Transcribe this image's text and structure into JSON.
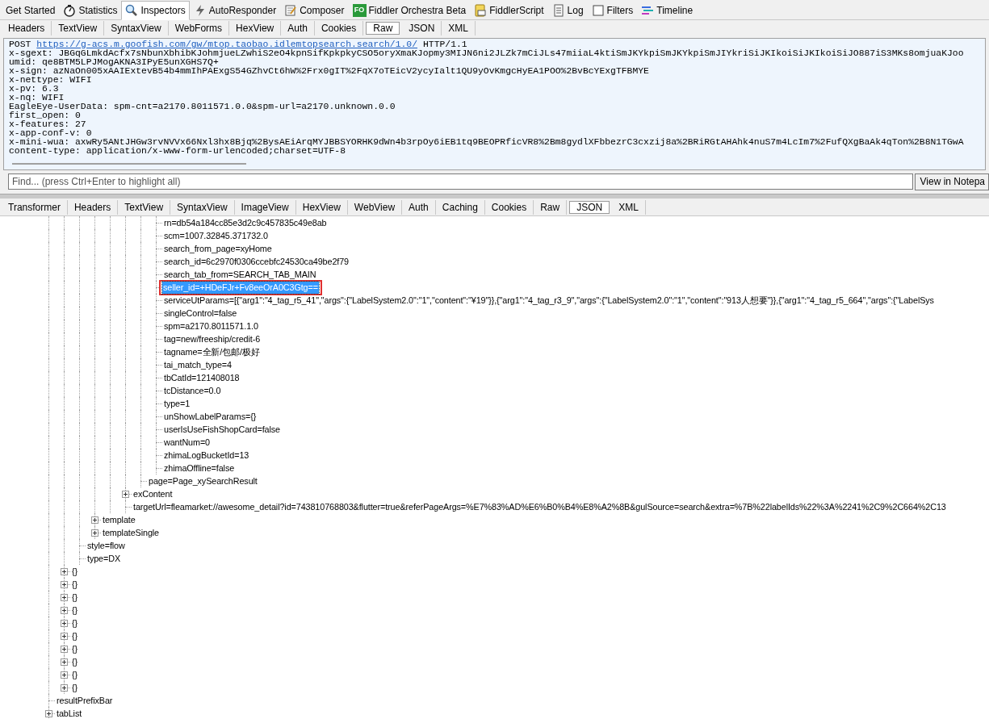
{
  "main_tabs": [
    {
      "label": "Get Started",
      "selected": false
    },
    {
      "label": "Statistics",
      "selected": false
    },
    {
      "label": "Inspectors",
      "selected": true
    },
    {
      "label": "AutoResponder",
      "selected": false
    },
    {
      "label": "Composer",
      "selected": false
    },
    {
      "label": "Fiddler Orchestra Beta",
      "selected": false,
      "badge": "FO"
    },
    {
      "label": "FiddlerScript",
      "selected": false
    },
    {
      "label": "Log",
      "selected": false
    },
    {
      "label": "Filters",
      "selected": false
    },
    {
      "label": "Timeline",
      "selected": false
    }
  ],
  "request_tabs": [
    {
      "label": "Headers",
      "selected": false
    },
    {
      "label": "TextView",
      "selected": false
    },
    {
      "label": "SyntaxView",
      "selected": false
    },
    {
      "label": "WebForms",
      "selected": false
    },
    {
      "label": "HexView",
      "selected": false
    },
    {
      "label": "Auth",
      "selected": false
    },
    {
      "label": "Cookies",
      "selected": false
    },
    {
      "label": "Raw",
      "selected": true
    },
    {
      "label": "JSON",
      "selected": false
    },
    {
      "label": "XML",
      "selected": false
    }
  ],
  "raw_request": {
    "method": "POST",
    "url": "https://g-acs.m.goofish.com/gw/mtop.taobao.idlemtopsearch.search/1.0/",
    "protocol": "HTTP/1.1",
    "lines": [
      "x-sgext: JBGqGLmkdAcfx7sNbunXbhibKJohmjueLZwhiS2eO4kpnSifKpkpkyCSO5oryXmaKJopmy3MIJN6ni2JLZk7mCiJLs47miiaL4ktiSmJKYkpiSmJKYkpiSmJIYkriSiJKIkoiSiJKIkoiSiJO887iS3MKs8omjuaKJoo",
      "umid: qe8BTM5LPJMogAKNA3IPyE5unXGHS7Q+",
      "x-sign: azNaOn005xAAIExtevB54b4mmIhPAExgS54GZhvCt6hW%2Frx0gIT%2FqX7oTEicV2ycyIalt1QU9yOvKmgcHyEA1POO%2BvBcYExgTFBMYE",
      "x-nettype: WIFI",
      "x-pv: 6.3",
      "x-nq: WIFI",
      "EagleEye-UserData: spm-cnt=a2170.8011571.0.0&spm-url=a2170.unknown.0.0",
      "first_open: 0",
      "x-features: 27",
      "x-app-conf-v: 0",
      "x-mini-wua: axwRy5ANtJHGw3rvNVVx66Nxl3hx8Bjq%2BysAEiArqMYJBBSYORHK9dWn4b3rpOy6iEB1tq9BEOPRficVR8%2Bm8gydlXFbbezrC3cxzij8a%2BRiRGtAHAhk4nuS7m4LcIm7%2FufQXgBaAk4qTon%2B8N1TGwA",
      "content-type: application/x-www-form-urlencoded;charset=UTF-8"
    ]
  },
  "find_bar": {
    "placeholder": "Find... (press Ctrl+Enter to highlight all)",
    "button": "View in Notepa"
  },
  "response_tabs": [
    {
      "label": "Transformer",
      "selected": false
    },
    {
      "label": "Headers",
      "selected": false
    },
    {
      "label": "TextView",
      "selected": false
    },
    {
      "label": "SyntaxView",
      "selected": false
    },
    {
      "label": "ImageView",
      "selected": false
    },
    {
      "label": "HexView",
      "selected": false
    },
    {
      "label": "WebView",
      "selected": false
    },
    {
      "label": "Auth",
      "selected": false
    },
    {
      "label": "Caching",
      "selected": false
    },
    {
      "label": "Cookies",
      "selected": false
    },
    {
      "label": "Raw",
      "selected": false
    },
    {
      "label": "JSON",
      "selected": true
    },
    {
      "label": "XML",
      "selected": false
    }
  ],
  "json_tree": [
    {
      "children": [
        {
          "children": [
            {
              "children": [
                {
                  "children": [
                    {
                      "children": [
                        {
                          "children": [
                            {
                              "children": [
                                {
                                  "label": "rn=db54a184cc85e3d2c9c457835c49e8ab",
                                  "selected": false
                                },
                                {
                                  "label": "scm=1007.32845.371732.0",
                                  "selected": false
                                },
                                {
                                  "label": "search_from_page=xyHome",
                                  "selected": false
                                },
                                {
                                  "label": "search_id=6c2970f0306ccebfc24530ca49be2f79",
                                  "selected": false
                                },
                                {
                                  "label": "search_tab_from=SEARCH_TAB_MAIN",
                                  "selected": false
                                },
                                {
                                  "label": "seller_id=+HDeFJr+Fv8eeOrA0C3Gtg==",
                                  "selected": true,
                                  "highlighted": true
                                },
                                {
                                  "label": "serviceUtParams=[{\"arg1\":\"4_tag_r5_41\",\"args\":{\"LabelSystem2.0\":\"1\",\"content\":\"¥19\"}},{\"arg1\":\"4_tag_r3_9\",\"args\":{\"LabelSystem2.0\":\"1\",\"content\":\"913人想要\"}},{\"arg1\":\"4_tag_r5_664\",\"args\":{\"LabelSys",
                                  "selected": false
                                },
                                {
                                  "label": "singleControl=false",
                                  "selected": false
                                },
                                {
                                  "label": "spm=a2170.8011571.1.0",
                                  "selected": false
                                },
                                {
                                  "label": "tag=new/freeship/credit-6",
                                  "selected": false
                                },
                                {
                                  "label": "tagname=全新/包邮/极好",
                                  "selected": false
                                },
                                {
                                  "label": "tai_match_type=4",
                                  "selected": false
                                },
                                {
                                  "label": "tbCatId=121408018",
                                  "selected": false
                                },
                                {
                                  "label": "tcDistance=0.0",
                                  "selected": false
                                },
                                {
                                  "label": "type=1",
                                  "selected": false
                                },
                                {
                                  "label": "unShowLabelParams={}",
                                  "selected": false
                                },
                                {
                                  "label": "userIsUseFishShopCard=false",
                                  "selected": false
                                },
                                {
                                  "label": "wantNum=0",
                                  "selected": false
                                },
                                {
                                  "label": "zhimaLogBucketId=13",
                                  "selected": false
                                },
                                {
                                  "label": "zhimaOffline=false",
                                  "selected": false
                                }
                              ]
                            },
                            {
                              "label": "page=Page_xySearchResult",
                              "selected": false
                            }
                          ]
                        },
                        {
                          "label": "exContent",
                          "selected": false,
                          "expanded": false
                        },
                        {
                          "label": "targetUrl=fleamarket://awesome_detail?id=743810768803&flutter=true&referPageArgs=%E7%83%AD%E6%B0%B4%E8%A2%8B&gulSource=search&extra=%7B%22labelIds%22%3A%2241%2C9%2C664%2C13",
                          "selected": false
                        }
                      ]
                    }
                  ]
                },
                {
                  "label": "template",
                  "selected": false,
                  "expanded": false
                },
                {
                  "label": "templateSingle",
                  "selected": false,
                  "expanded": false
                }
              ]
            },
            {
              "label": "style=flow",
              "selected": false
            },
            {
              "label": "type=DX",
              "selected": false
            }
          ]
        },
        {
          "label": "{}",
          "selected": false,
          "expanded": false
        },
        {
          "label": "{}",
          "selected": false,
          "expanded": false
        },
        {
          "label": "{}",
          "selected": false,
          "expanded": false
        },
        {
          "label": "{}",
          "selected": false,
          "expanded": false
        },
        {
          "label": "{}",
          "selected": false,
          "expanded": false
        },
        {
          "label": "{}",
          "selected": false,
          "expanded": false
        },
        {
          "label": "{}",
          "selected": false,
          "expanded": false
        },
        {
          "label": "{}",
          "selected": false,
          "expanded": false
        },
        {
          "label": "{}",
          "selected": false,
          "expanded": false
        },
        {
          "label": "{}",
          "selected": false,
          "expanded": false
        }
      ]
    },
    {
      "label": "resultPrefixBar",
      "selected": false
    },
    {
      "label": "tabList",
      "selected": false,
      "expanded": false
    }
  ]
}
